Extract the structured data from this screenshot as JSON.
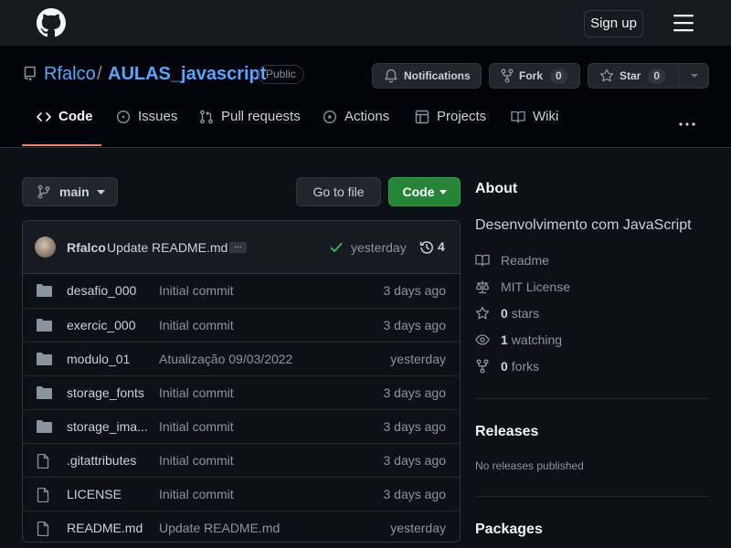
{
  "header": {
    "signup_label": "Sign up"
  },
  "repo": {
    "owner": "Rfalco",
    "separator": "/",
    "name": "AULAS_javascript",
    "visibility": "Public",
    "notifications_label": "Notifications",
    "fork_label": "Fork",
    "fork_count": "0",
    "star_label": "Star",
    "star_count": "0"
  },
  "tabs": [
    {
      "label": "Code",
      "icon": "code-icon"
    },
    {
      "label": "Issues",
      "icon": "issue-icon"
    },
    {
      "label": "Pull requests",
      "icon": "pull-request-icon"
    },
    {
      "label": "Actions",
      "icon": "play-icon"
    },
    {
      "label": "Projects",
      "icon": "table-icon"
    },
    {
      "label": "Wiki",
      "icon": "book-icon"
    }
  ],
  "toolbar": {
    "branch": "main",
    "goto_file": "Go to file",
    "code_button": "Code"
  },
  "commit": {
    "author": "Rfalco",
    "message": "Update README.md",
    "ellipsis": "...",
    "time": "yesterday",
    "count": "4"
  },
  "files": [
    {
      "type": "dir",
      "name": "desafio_000",
      "message": "Initial commit",
      "time": "3 days ago"
    },
    {
      "type": "dir",
      "name": "exercic_000",
      "message": "Initial commit",
      "time": "3 days ago"
    },
    {
      "type": "dir",
      "name": "modulo_01",
      "message": "Atualização 09/03/2022",
      "time": "yesterday"
    },
    {
      "type": "dir",
      "name": "storage_fonts",
      "message": "Initial commit",
      "time": "3 days ago"
    },
    {
      "type": "dir",
      "name": "storage_ima...",
      "message": "Initial commit",
      "time": "3 days ago"
    },
    {
      "type": "file",
      "name": ".gitattributes",
      "message": "Initial commit",
      "time": "3 days ago"
    },
    {
      "type": "file",
      "name": "LICENSE",
      "message": "Initial commit",
      "time": "3 days ago"
    },
    {
      "type": "file",
      "name": "README.md",
      "message": "Update README.md",
      "time": "yesterday"
    }
  ],
  "about": {
    "heading": "About",
    "description": "Desenvolvimento com JavaScript",
    "readme": "Readme",
    "license": "MIT License",
    "stars_count": "0",
    "stars_label": "stars",
    "watching_count": "1",
    "watching_label": "watching",
    "forks_count": "0",
    "forks_label": "forks"
  },
  "releases": {
    "heading": "Releases",
    "empty": "No releases published"
  },
  "packages": {
    "heading": "Packages"
  },
  "colors": {
    "accent_link": "#58a6ff",
    "code_button": "#238636",
    "tab_underline": "#f78166",
    "background": "#0d1117"
  }
}
